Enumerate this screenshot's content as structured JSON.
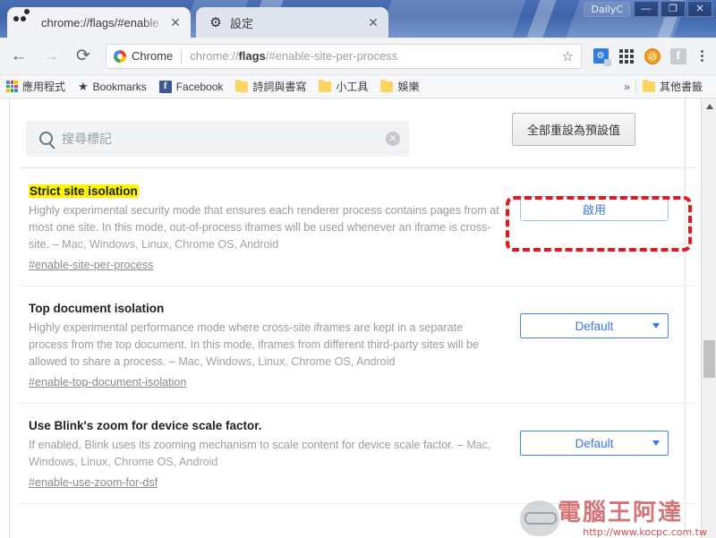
{
  "window": {
    "session_label": "DailyC",
    "minimize_label": "—",
    "maximize_label": "❐",
    "close_label": "✕"
  },
  "tabs": [
    {
      "title": "chrome://flags/#enable",
      "icon": "chrome-flags-icon",
      "close_label": "✕",
      "active": true
    },
    {
      "title": "設定",
      "icon": "gear-icon",
      "close_label": "✕",
      "active": false
    }
  ],
  "toolbar": {
    "back_label": "←",
    "forward_label": "→",
    "reload_label": "⟳",
    "chrome_chip_label": "Chrome",
    "url_prefix": "chrome://",
    "url_bold": "flags",
    "url_suffix": "/#enable-site-per-process",
    "url_full": "chrome://flags/#enable-site-per-process",
    "star_label": "☆",
    "extension_badge_label": "",
    "apps_grid_label": "apps-grid-icon",
    "orange_ext_label": "⊘",
    "facebook_ext_label": "f",
    "menu_label": "⋮"
  },
  "bookmarks": {
    "items": [
      {
        "label": "應用程式",
        "icon": "apps-grid-icon"
      },
      {
        "label": "Bookmarks",
        "icon": "star-icon"
      },
      {
        "label": "Facebook",
        "icon": "facebook-icon"
      },
      {
        "label": "詩詞與書寫",
        "icon": "folder-icon"
      },
      {
        "label": "小工具",
        "icon": "folder-icon"
      },
      {
        "label": "娛樂",
        "icon": "folder-icon"
      }
    ],
    "overflow_label": "»",
    "other_bookmarks": {
      "label": "其他書籤",
      "icon": "folder-icon"
    }
  },
  "search": {
    "placeholder": "搜尋標記",
    "value": "",
    "clear_label": "✕"
  },
  "reset": {
    "label": "全部重設為預設值"
  },
  "flags": [
    {
      "title": "Strict site isolation",
      "highlighted": true,
      "description": "Highly experimental security mode that ensures each renderer process contains pages from at most one site. In this mode, out-of-process iframes will be used whenever an iframe is cross-site.",
      "platforms": "– Mac, Windows, Linux, Chrome OS, Android",
      "permalink": "#enable-site-per-process",
      "control": {
        "type": "button",
        "label": "啟用"
      },
      "annotated": true
    },
    {
      "title": "Top document isolation",
      "highlighted": false,
      "description": "Highly experimental performance mode where cross-site iframes are kept in a separate process from the top document. In this mode, iframes from different third-party sites will be allowed to share a process.",
      "platforms": "– Mac, Windows, Linux, Chrome OS, Android",
      "permalink": "#enable-top-document-isolation",
      "control": {
        "type": "select",
        "label": "Default"
      },
      "annotated": false
    },
    {
      "title": "Use Blink's zoom for device scale factor.",
      "highlighted": false,
      "description": "If enabled, Blink uses its zooming mechanism to scale content for device scale factor.",
      "platforms": "– Mac, Windows, Linux, Chrome OS, Android",
      "permalink": "#enable-use-zoom-for-dsf",
      "control": {
        "type": "select",
        "label": "Default"
      },
      "annotated": false
    }
  ],
  "scrollbar": {
    "up_arrow_label": "▲"
  },
  "watermark": {
    "text": "電腦王阿達",
    "url": "http://www.kocpc.com.tw"
  },
  "colors": {
    "highlight": "#fdf400",
    "annotation": "#e8171a",
    "link_blue": "#3b78e7",
    "titlebar": "#3e63a8"
  }
}
